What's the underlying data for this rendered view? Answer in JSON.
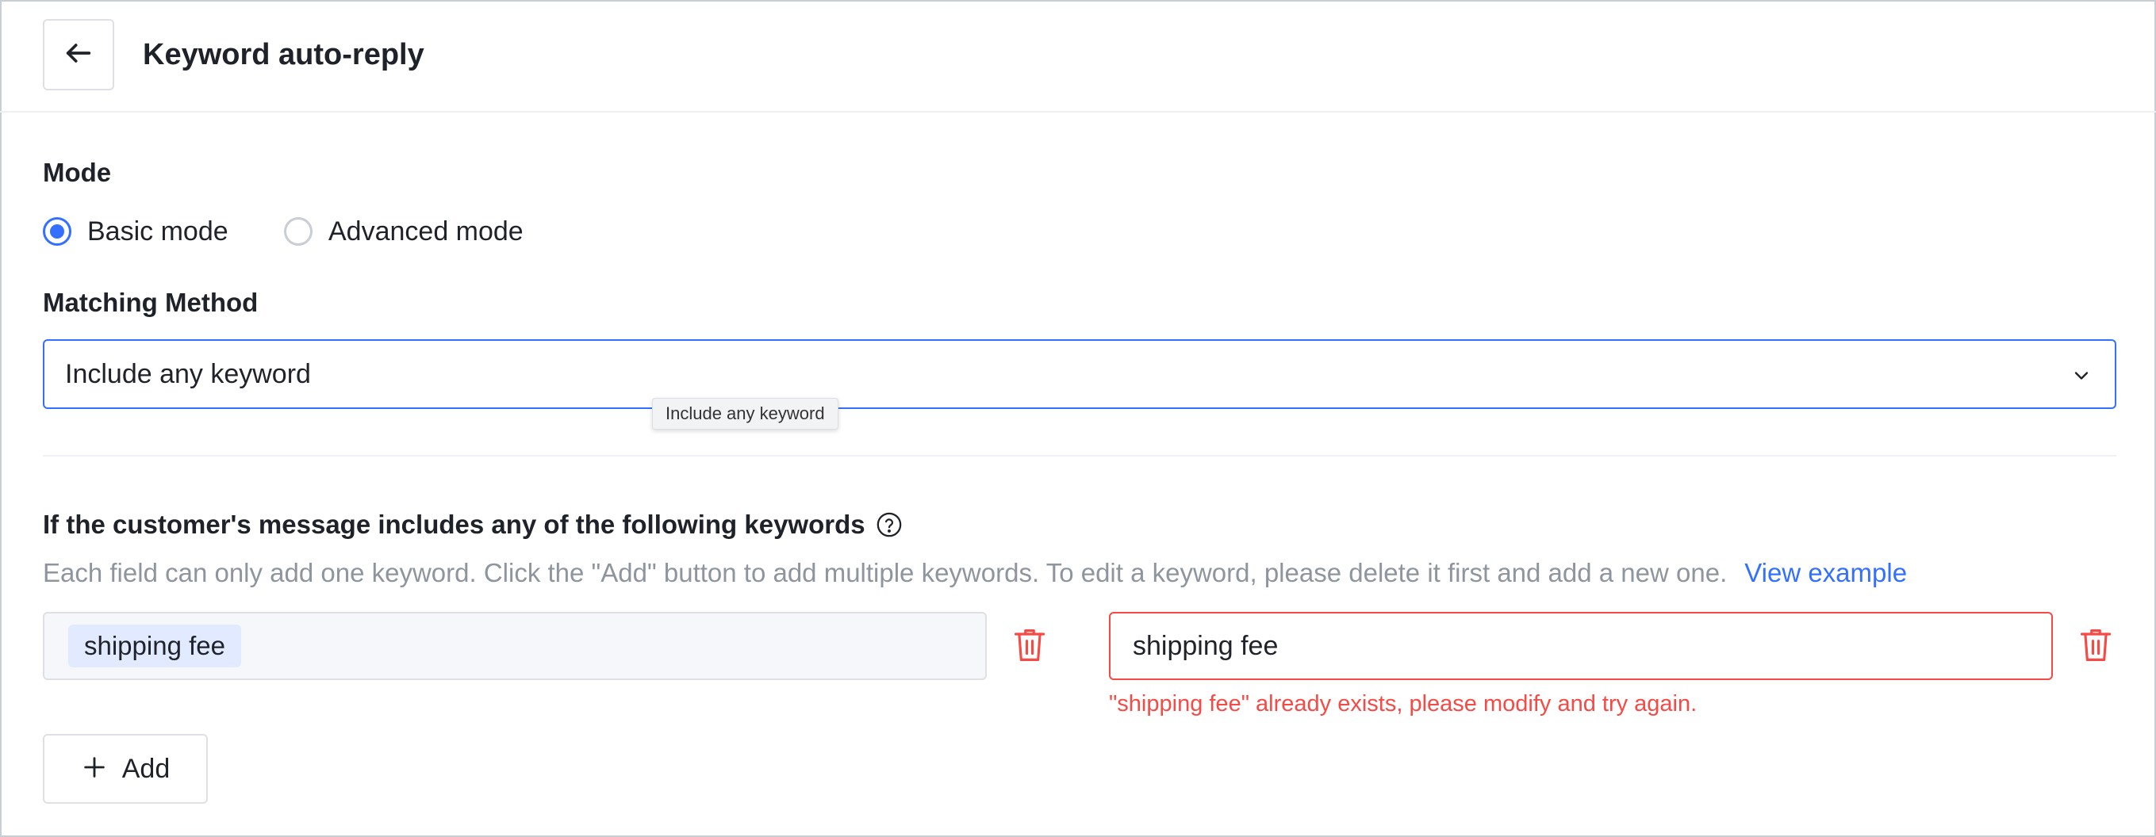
{
  "header": {
    "back_icon": "arrow-left-icon",
    "title": "Keyword auto-reply"
  },
  "mode": {
    "label": "Mode",
    "options": [
      {
        "label": "Basic mode",
        "checked": true
      },
      {
        "label": "Advanced mode",
        "checked": false
      }
    ]
  },
  "matching": {
    "label": "Matching Method",
    "selected": "Include any keyword",
    "tooltip": "Include any keyword",
    "chevron_icon": "chevron-down-icon"
  },
  "keywords": {
    "heading": "If the customer's message includes any of the following keywords",
    "help_icon": "question-circle-icon",
    "hint": "Each field can only add one keyword. Click the \"Add\" button to add multiple keywords. To edit a keyword, please delete it first and add a new one.",
    "hint_link": "View example",
    "fields": [
      {
        "tag": "shipping fee"
      },
      {
        "value": "shipping fee",
        "error": "\"shipping fee\" already exists, please modify and try again."
      }
    ],
    "delete_icon": "trash-icon",
    "add_label": "Add",
    "add_icon": "plus-icon"
  },
  "colors": {
    "accent": "#3370ff",
    "error": "#f54a45",
    "tag_bg": "#e1eaff",
    "muted_text": "#8f959e"
  }
}
